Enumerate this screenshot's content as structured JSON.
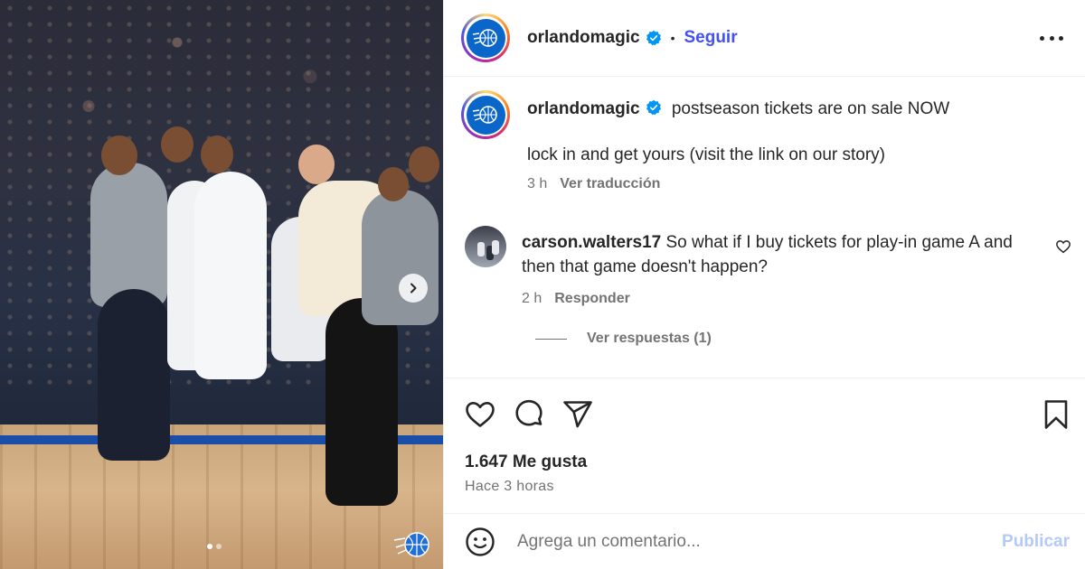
{
  "post": {
    "account": {
      "username": "orlandomagic",
      "follow_label": "Seguir",
      "separator": "•"
    },
    "caption": {
      "username": "orlandomagic",
      "line1": "postseason tickets are on sale NOW",
      "line2": "lock in and get yours (visit the link on our story)",
      "time": "3 h",
      "translate_label": "Ver traducción"
    },
    "comments": [
      {
        "username": "carson.walters17",
        "text": "So what if I buy tickets for play-in game A and then that game doesn't happen?",
        "time": "2 h",
        "reply_label": "Responder",
        "view_replies_label": "Ver respuestas (1)"
      }
    ],
    "likes_label": "1.647 Me gusta",
    "posted_label": "Hace 3 horas",
    "comment_input": {
      "placeholder": "Agrega un comentario...",
      "publish_label": "Publicar"
    },
    "carousel": {
      "total_slides": 2,
      "active_slide": 1
    },
    "colors": {
      "accent_blue": "#4150f7",
      "publish_disabled": "#b3c9f8",
      "verified_blue": "#0095f6",
      "magic_blue": "#0b66c9",
      "muted_text": "#737373"
    },
    "icons": [
      "verified-icon",
      "more-options-icon",
      "heart-icon",
      "comment-icon",
      "share-icon",
      "bookmark-icon",
      "emoji-icon",
      "chevron-right-icon"
    ]
  }
}
